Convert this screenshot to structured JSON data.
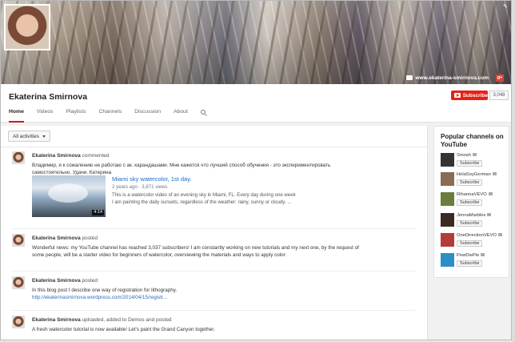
{
  "banner": {
    "site_link": "www.ekaterina-smirnova.com",
    "gplus_label": "g+"
  },
  "channel": {
    "name": "Ekaterina Smirnova",
    "subscribe_label": "Subscribe",
    "subscriber_count": "3,048"
  },
  "tabs": [
    {
      "label": "Home",
      "active": true
    },
    {
      "label": "Videos"
    },
    {
      "label": "Playlists"
    },
    {
      "label": "Channels"
    },
    {
      "label": "Discussion"
    },
    {
      "label": "About"
    }
  ],
  "feed": {
    "filter_label": "All activities",
    "activities": [
      {
        "author": "Ekaterina Smirnova",
        "action": "commented",
        "text": "Владимир, я к сожалению не работаю с ак. карандашами. Мне кажется что лучший способ обучения - это экспериментировать самостоятельно. Удачи. Катерина",
        "video": {
          "title": "Miami sky watercolor, 1st day.",
          "meta": "2 years ago · 3,871 views",
          "description": "This is a watercolor video of an evening sky in Miami, FL. Every day during one week I am painting the daily sunsets, regardless of the weather: rainy, sunny or cloudy. ...",
          "duration": "4:14"
        }
      },
      {
        "author": "Ekaterina Smirnova",
        "action": "posted",
        "text": "Wonderful news: my YouTube channel has reached 3,037 subscribers! I am constantly working on new tutorials and my next one, by the request of some people, will be a starter video for beginners of watercolor, overviewing the materials and ways to apply color."
      },
      {
        "author": "Ekaterina Smirnova",
        "action": "posted",
        "text": "In this blog post I describe one way of registration for lithography.",
        "link": "http://ekaterinasmirnova.wordpress.com/2014/04/15/registr..."
      },
      {
        "author": "Ekaterina Smirnova",
        "action": "uploaded, added to Demos and posted",
        "text": "A fresh watercolor tutorial is now available! Let's paint the Grand Canyon together."
      }
    ]
  },
  "sidebar": {
    "title": "Popular channels on YouTube",
    "subscribe_label": "Subscribe",
    "channels": [
      {
        "name": "Smosh",
        "color": "#333333"
      },
      {
        "name": "HolaSoyGerman",
        "color": "#8a6b55"
      },
      {
        "name": "RihannaVEVO",
        "color": "#6b7d3a"
      },
      {
        "name": "JennaMarbles",
        "color": "#3b2a22"
      },
      {
        "name": "OneDirectionVEVO",
        "color": "#b23b3b"
      },
      {
        "name": "PewDiePie",
        "color": "#2a8fc9"
      }
    ]
  }
}
